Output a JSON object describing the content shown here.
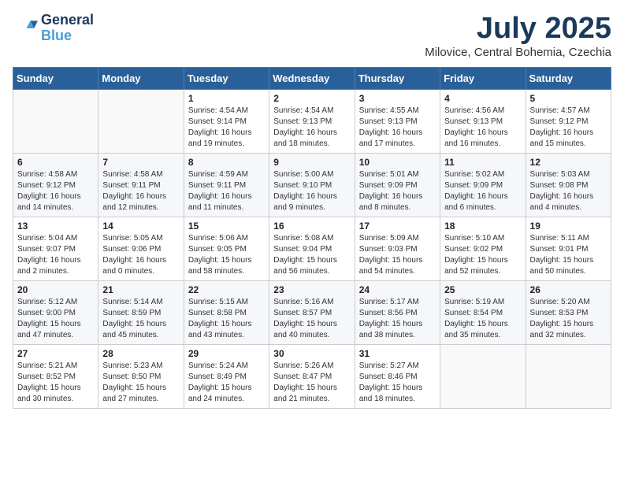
{
  "logo": {
    "line1": "General",
    "line2": "Blue"
  },
  "title": "July 2025",
  "location": "Milovice, Central Bohemia, Czechia",
  "weekdays": [
    "Sunday",
    "Monday",
    "Tuesday",
    "Wednesday",
    "Thursday",
    "Friday",
    "Saturday"
  ],
  "weeks": [
    [
      {
        "day": "",
        "info": ""
      },
      {
        "day": "",
        "info": ""
      },
      {
        "day": "1",
        "info": "Sunrise: 4:54 AM\nSunset: 9:14 PM\nDaylight: 16 hours and 19 minutes."
      },
      {
        "day": "2",
        "info": "Sunrise: 4:54 AM\nSunset: 9:13 PM\nDaylight: 16 hours and 18 minutes."
      },
      {
        "day": "3",
        "info": "Sunrise: 4:55 AM\nSunset: 9:13 PM\nDaylight: 16 hours and 17 minutes."
      },
      {
        "day": "4",
        "info": "Sunrise: 4:56 AM\nSunset: 9:13 PM\nDaylight: 16 hours and 16 minutes."
      },
      {
        "day": "5",
        "info": "Sunrise: 4:57 AM\nSunset: 9:12 PM\nDaylight: 16 hours and 15 minutes."
      }
    ],
    [
      {
        "day": "6",
        "info": "Sunrise: 4:58 AM\nSunset: 9:12 PM\nDaylight: 16 hours and 14 minutes."
      },
      {
        "day": "7",
        "info": "Sunrise: 4:58 AM\nSunset: 9:11 PM\nDaylight: 16 hours and 12 minutes."
      },
      {
        "day": "8",
        "info": "Sunrise: 4:59 AM\nSunset: 9:11 PM\nDaylight: 16 hours and 11 minutes."
      },
      {
        "day": "9",
        "info": "Sunrise: 5:00 AM\nSunset: 9:10 PM\nDaylight: 16 hours and 9 minutes."
      },
      {
        "day": "10",
        "info": "Sunrise: 5:01 AM\nSunset: 9:09 PM\nDaylight: 16 hours and 8 minutes."
      },
      {
        "day": "11",
        "info": "Sunrise: 5:02 AM\nSunset: 9:09 PM\nDaylight: 16 hours and 6 minutes."
      },
      {
        "day": "12",
        "info": "Sunrise: 5:03 AM\nSunset: 9:08 PM\nDaylight: 16 hours and 4 minutes."
      }
    ],
    [
      {
        "day": "13",
        "info": "Sunrise: 5:04 AM\nSunset: 9:07 PM\nDaylight: 16 hours and 2 minutes."
      },
      {
        "day": "14",
        "info": "Sunrise: 5:05 AM\nSunset: 9:06 PM\nDaylight: 16 hours and 0 minutes."
      },
      {
        "day": "15",
        "info": "Sunrise: 5:06 AM\nSunset: 9:05 PM\nDaylight: 15 hours and 58 minutes."
      },
      {
        "day": "16",
        "info": "Sunrise: 5:08 AM\nSunset: 9:04 PM\nDaylight: 15 hours and 56 minutes."
      },
      {
        "day": "17",
        "info": "Sunrise: 5:09 AM\nSunset: 9:03 PM\nDaylight: 15 hours and 54 minutes."
      },
      {
        "day": "18",
        "info": "Sunrise: 5:10 AM\nSunset: 9:02 PM\nDaylight: 15 hours and 52 minutes."
      },
      {
        "day": "19",
        "info": "Sunrise: 5:11 AM\nSunset: 9:01 PM\nDaylight: 15 hours and 50 minutes."
      }
    ],
    [
      {
        "day": "20",
        "info": "Sunrise: 5:12 AM\nSunset: 9:00 PM\nDaylight: 15 hours and 47 minutes."
      },
      {
        "day": "21",
        "info": "Sunrise: 5:14 AM\nSunset: 8:59 PM\nDaylight: 15 hours and 45 minutes."
      },
      {
        "day": "22",
        "info": "Sunrise: 5:15 AM\nSunset: 8:58 PM\nDaylight: 15 hours and 43 minutes."
      },
      {
        "day": "23",
        "info": "Sunrise: 5:16 AM\nSunset: 8:57 PM\nDaylight: 15 hours and 40 minutes."
      },
      {
        "day": "24",
        "info": "Sunrise: 5:17 AM\nSunset: 8:56 PM\nDaylight: 15 hours and 38 minutes."
      },
      {
        "day": "25",
        "info": "Sunrise: 5:19 AM\nSunset: 8:54 PM\nDaylight: 15 hours and 35 minutes."
      },
      {
        "day": "26",
        "info": "Sunrise: 5:20 AM\nSunset: 8:53 PM\nDaylight: 15 hours and 32 minutes."
      }
    ],
    [
      {
        "day": "27",
        "info": "Sunrise: 5:21 AM\nSunset: 8:52 PM\nDaylight: 15 hours and 30 minutes."
      },
      {
        "day": "28",
        "info": "Sunrise: 5:23 AM\nSunset: 8:50 PM\nDaylight: 15 hours and 27 minutes."
      },
      {
        "day": "29",
        "info": "Sunrise: 5:24 AM\nSunset: 8:49 PM\nDaylight: 15 hours and 24 minutes."
      },
      {
        "day": "30",
        "info": "Sunrise: 5:26 AM\nSunset: 8:47 PM\nDaylight: 15 hours and 21 minutes."
      },
      {
        "day": "31",
        "info": "Sunrise: 5:27 AM\nSunset: 8:46 PM\nDaylight: 15 hours and 18 minutes."
      },
      {
        "day": "",
        "info": ""
      },
      {
        "day": "",
        "info": ""
      }
    ]
  ]
}
